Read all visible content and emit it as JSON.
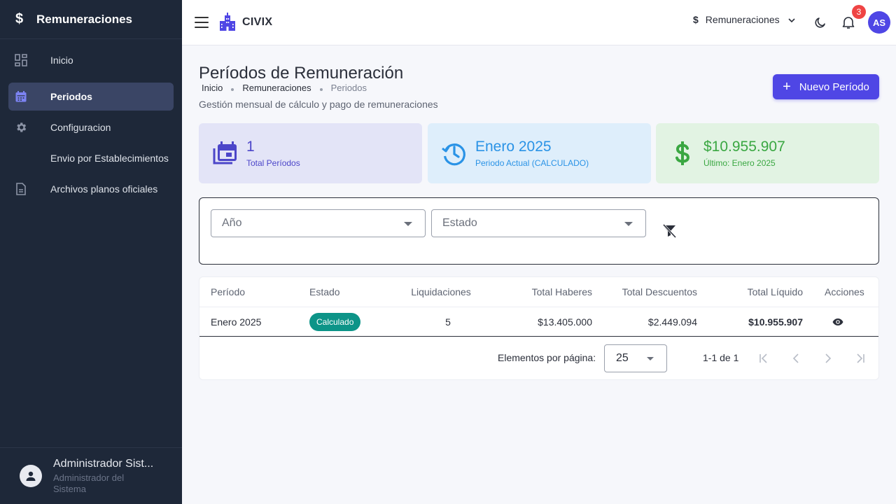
{
  "sidebar": {
    "title": "Remuneraciones",
    "title_icon": "$",
    "items": [
      {
        "label": "Inicio",
        "icon": "dashboard-icon"
      },
      {
        "label": "Periodos",
        "icon": "calendar-icon",
        "active": true
      },
      {
        "label": "Configuracion",
        "icon": "gear-icon"
      },
      {
        "label": "Envio por Establecimientos",
        "icon": ""
      },
      {
        "label": "Archivos planos oficiales",
        "icon": "document-icon"
      }
    ],
    "user": {
      "name": "Administrador Sist...",
      "role": "Administrador del Sistema"
    }
  },
  "topbar": {
    "brand": "CIVIX",
    "module_icon": "$",
    "module_label": "Remuneraciones",
    "notification_count": "3",
    "avatar_initials": "AS"
  },
  "page": {
    "title": "Períodos de Remuneración",
    "breadcrumb": [
      "Inicio",
      "Remuneraciones",
      "Periodos"
    ],
    "subtitle": "Gestión mensual de cálculo y pago de remuneraciones",
    "new_button": "Nuevo Período",
    "new_button_icon": "+"
  },
  "cards": [
    {
      "value": "1",
      "label": "Total Períodos",
      "color": "#4c46c9"
    },
    {
      "value": "Enero 2025",
      "label": "Periodo Actual (CALCULADO)",
      "color": "#2a93e6"
    },
    {
      "value": "$10.955.907",
      "label": "Último: Enero 2025",
      "color": "#3aa742"
    }
  ],
  "filters": {
    "year_placeholder": "Año",
    "status_placeholder": "Estado"
  },
  "table": {
    "headers": [
      "Período",
      "Estado",
      "Liquidaciones",
      "Total Haberes",
      "Total Descuentos",
      "Total Líquido",
      "Acciones"
    ],
    "rows": [
      {
        "period": "Enero 2025",
        "status": "Calculado",
        "settlements": "5",
        "total_haberes": "$13.405.000",
        "total_descuentos": "$2.449.094",
        "total_liquido": "$10.955.907"
      }
    ]
  },
  "pagination": {
    "items_per_page_label": "Elementos por página:",
    "page_size": "25",
    "range": "1-1 de 1"
  },
  "colors": {
    "accent": "#4f46e5",
    "sidebar_bg": "#1e2839",
    "status_calculado": "#0d9488",
    "badge": "#ef4444"
  }
}
